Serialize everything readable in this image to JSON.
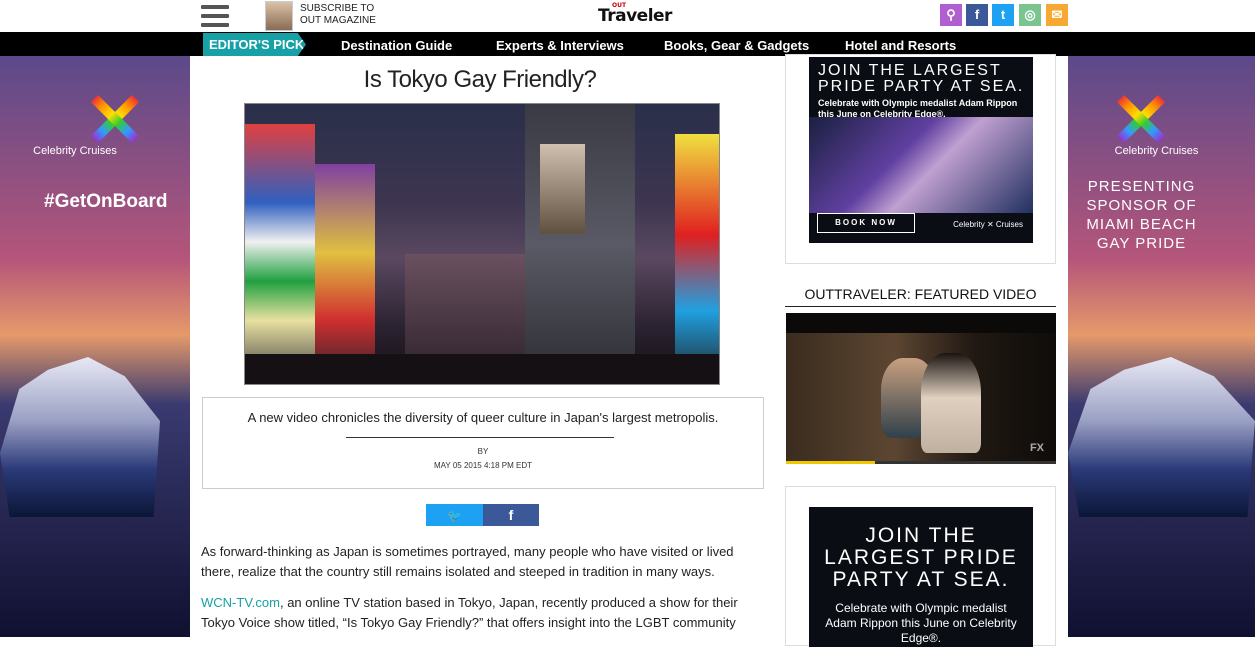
{
  "header": {
    "subscribe_line1": "SUBSCRIBE TO",
    "subscribe_line2": "OUT MAGAZINE",
    "logo_small": "OUT",
    "logo": "Traveler",
    "social": [
      {
        "name": "search-icon",
        "glyph": "⚲",
        "color": "#b05fd0"
      },
      {
        "name": "facebook-icon",
        "glyph": "f",
        "color": "#3b5998"
      },
      {
        "name": "twitter-icon",
        "glyph": "t",
        "color": "#1da1f2"
      },
      {
        "name": "instagram-icon",
        "glyph": "◎",
        "color": "#7bc48f"
      },
      {
        "name": "email-icon",
        "glyph": "✉",
        "color": "#f7a832"
      }
    ]
  },
  "nav": {
    "editors_pick": "EDITOR'S PICK",
    "links": [
      "Destination Guide",
      "Experts & Interviews",
      "Books, Gear & Gadgets",
      "Hotel and Resorts"
    ]
  },
  "left_ad": {
    "brand": "Celebrity Cruises",
    "hashtag": "#GetOnBoard"
  },
  "right_ad": {
    "brand": "Celebrity Cruises",
    "text": "PRESENTING SPONSOR OF MIAMI BEACH GAY PRIDE"
  },
  "article": {
    "title": "Is Tokyo Gay Friendly?",
    "deck": "A new video chronicles the diversity of queer culture in Japan's largest metropolis.",
    "by": "BY",
    "date": "MAY 05 2015 4:18 PM EDT",
    "share_twitter": "🐦",
    "share_facebook": "f",
    "para1": "As forward-thinking as Japan is sometimes portrayed, many people who have visited or lived there, realize that the country still remains isolated and steeped in tradition in many ways.",
    "para2_link": "WCN-TV.com",
    "para2": ", an online TV station based in Tokyo, Japan, recently produced a show for their Tokyo Voice show titled, “Is Tokyo Gay Friendly?” that offers insight into the LGBT community"
  },
  "sidebar": {
    "ad1": {
      "headline": "JOIN THE LARGEST PRIDE PARTY AT SEA.",
      "sub": "Celebrate with Olympic medalist Adam Rippon this June on Celebrity Edge®.",
      "button": "BOOK NOW",
      "logo": "Celebrity ✕ Cruises"
    },
    "video_title": "OUTTRAVELER: FEATURED VIDEO",
    "video_badge": "FX",
    "video_progress": 0.33,
    "ad2": {
      "headline": "JOIN THE LARGEST PRIDE PARTY AT SEA.",
      "sub": "Celebrate with Olympic medalist Adam Rippon this June on Celebrity Edge®."
    }
  }
}
